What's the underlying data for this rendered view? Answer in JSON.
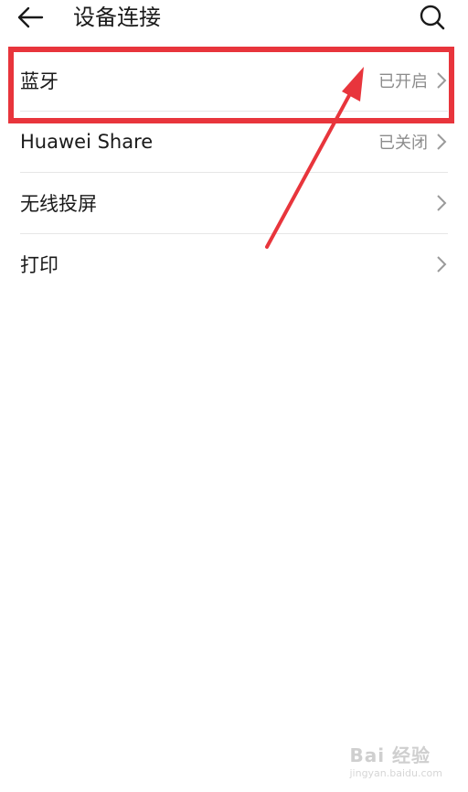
{
  "header": {
    "title": "设备连接",
    "back_icon": "arrow-left-icon",
    "search_icon": "search-icon"
  },
  "items": [
    {
      "label": "蓝牙",
      "status": "已开启"
    },
    {
      "label": "Huawei Share",
      "status": "已关闭"
    },
    {
      "label": "无线投屏",
      "status": ""
    },
    {
      "label": "打印",
      "status": ""
    }
  ],
  "annotation": {
    "color": "#e8353c"
  },
  "watermark": {
    "main": "Bai 经验",
    "sub": "jingyan.baidu.com"
  }
}
